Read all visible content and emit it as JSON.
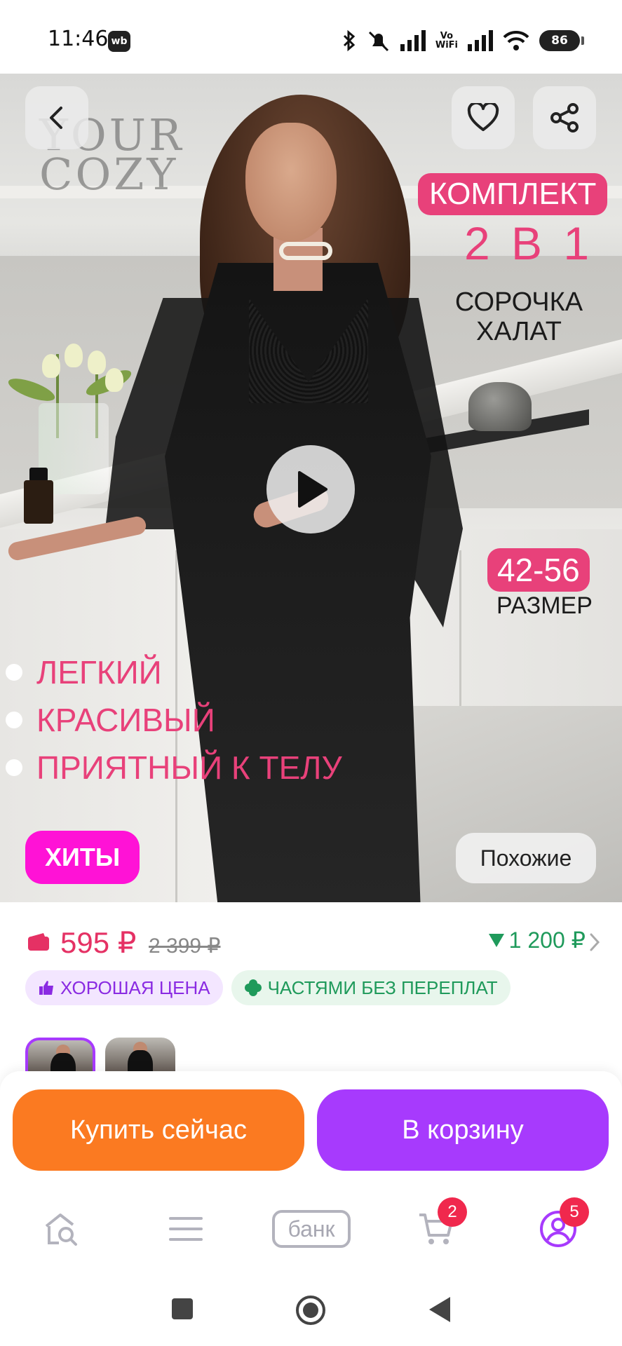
{
  "status_bar": {
    "time": "11:46",
    "app_badge": "wb",
    "vowifi_line1": "Vo",
    "vowifi_line2": "WiFi",
    "battery": "86"
  },
  "hero": {
    "brand_logo_line1": "YOUR",
    "brand_logo_line2": "COZY",
    "promo_badge": "КОМПЛЕКТ",
    "promo_big": "2 В 1",
    "promo_item_1": "СОРОЧКА",
    "promo_item_2": "ХАЛАТ",
    "size_range": "42-56",
    "size_label": "РАЗМЕР",
    "features": [
      "ЛЕГКИЙ",
      "КРАСИВЫЙ",
      "ПРИЯТНЫЙ К ТЕЛУ"
    ],
    "hits_badge": "ХИТЫ",
    "similar_button": "Похожие"
  },
  "price": {
    "current": "595 ₽",
    "old": "2 399 ₽",
    "drop": "1 200 ₽"
  },
  "chips": {
    "good_price": "ХОРОШАЯ ЦЕНА",
    "installments": "ЧАСТЯМИ БЕЗ ПЕРЕПЛАТ"
  },
  "actions": {
    "buy_now": "Купить сейчас",
    "add_to_cart": "В корзину"
  },
  "bottom_nav": {
    "bank_label": "банк",
    "cart_badge": "2",
    "profile_badge": "5"
  },
  "colors": {
    "accent_pink": "#e8417a",
    "buy_orange": "#fb7a21",
    "cart_purple": "#a73afd",
    "hits_magenta": "#ff12d6",
    "price_red": "#e53164",
    "green": "#1f9a5b"
  }
}
